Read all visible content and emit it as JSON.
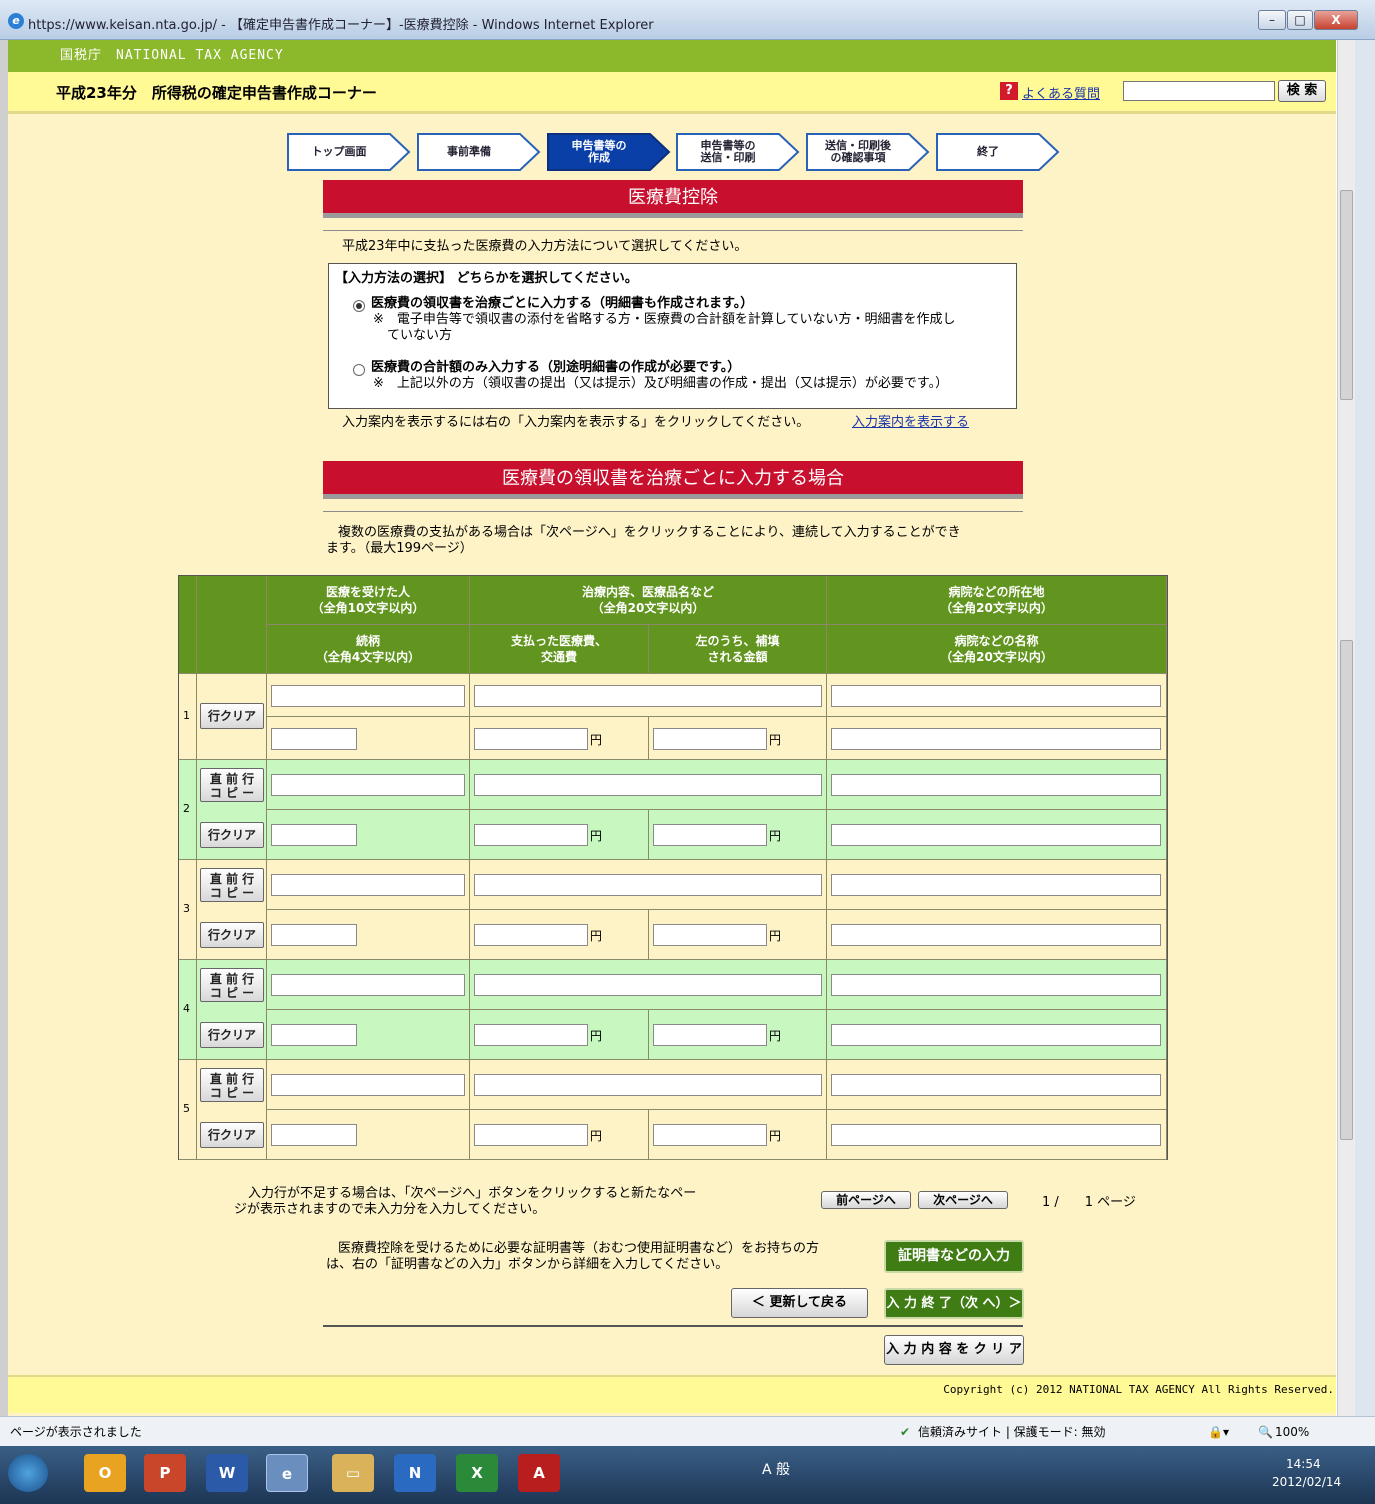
{
  "window": {
    "title": "https://www.keisan.nta.go.jp/ - 【確定申告書作成コーナー】-医療費控除 - Windows Internet Explorer",
    "min": "–",
    "max": "□",
    "close": "X"
  },
  "header": {
    "agency": "国税庁　NATIONAL TAX AGENCY",
    "page_title": "平成23年分　所得税の確定申告書作成コーナー",
    "faq_icon": "?",
    "faq_link": "よくある質問",
    "search_button": "検 索"
  },
  "steps": [
    {
      "label": "トップ画面",
      "active": false
    },
    {
      "label": "事前準備",
      "active": false
    },
    {
      "label": "申告書等の\n作成",
      "active": true
    },
    {
      "label": "申告書等の\n送信・印刷",
      "active": false
    },
    {
      "label": "送信・印刷後\nの確認事項",
      "active": false
    },
    {
      "label": "終了",
      "active": false
    }
  ],
  "section1": {
    "title": "医療費控除",
    "intro": "平成23年中に支払った医療費の入力方法について選択してください。",
    "box_heading": "【入力方法の選択】 どちらかを選択してください。",
    "option1": "医療費の領収書を治療ごとに入力する（明細書も作成されます。）",
    "option1_note1": "※　電子申告等で領収書の添付を省略する方・医療費の合計額を計算していない方・明細書を作成し",
    "option1_note2": "ていない方",
    "option2": "医療費の合計額のみ入力する（別途明細書の作成が必要です。）",
    "option2_note": "※　上記以外の方（領収書の提出（又は提示）及び明細書の作成・提出（又は提示）が必要です。）",
    "guide_text": "入力案内を表示するには右の「入力案内を表示する」をクリックしてください。",
    "guide_link": "入力案内を表示する"
  },
  "section2": {
    "title": "医療費の領収書を治療ごとに入力する場合",
    "note1": "複数の医療費の支払がある場合は「次ページへ」をクリックすることにより、連続して入力することができ",
    "note2": "ます。（最大199ページ）"
  },
  "table": {
    "h_person": "医療を受けた人\n（全角10文字以内）",
    "h_content": "治療内容、医療品名など\n（全角20文字以内）",
    "h_location": "病院などの所在地\n（全角20文字以内）",
    "h_relation": "続柄\n（全角4文字以内）",
    "h_paid": "支払った医療費、\n交通費",
    "h_reimbursed": "左のうち、補填\nされる金額",
    "h_hospital": "病院などの名称\n（全角20文字以内）",
    "yen": "円",
    "clear_row": "行クリア",
    "copy_prev": "直 前 行\nコ ピ ー",
    "row_numbers": [
      "1",
      "2",
      "3",
      "4",
      "5"
    ]
  },
  "bottom": {
    "more_rows1": "入力行が不足する場合は、「次ページへ」ボタンをクリックすると新たなペー",
    "more_rows2": "ジが表示されますので未入力分を入力してください。",
    "prev_page": "前ページへ",
    "next_page": "次ページへ",
    "page_indicator": "1 /　　1 ページ",
    "cert_text1": "医療費控除を受けるために必要な証明書等（おむつ使用証明書など）をお持ちの方",
    "cert_text2": "は、右の「証明書などの入力」ボタンから詳細を入力してください。",
    "cert_button": "証明書などの入力",
    "back_button": "＜ 更新して戻る",
    "finish_button": "入 力 終 了（次 へ）＞",
    "clear_button": "入 力 内 容 を ク リ ア",
    "copyright": "Copyright (c) 2012 NATIONAL TAX AGENCY All Rights Reserved."
  },
  "status": {
    "left": "ページが表示されました",
    "security": "信頼済みサイト | 保護モード: 無効",
    "zoom": "100%"
  },
  "taskbar": {
    "ime": "A 般",
    "time": "14:54",
    "date": "2012/02/14"
  },
  "colors": {
    "agency_green": "#8cb82b",
    "header_yellow": "#fff996",
    "page_bg": "#fdf3c7",
    "band_red": "#c8102e",
    "table_header_green": "#62951f",
    "alt_row_green": "#c8f7c0",
    "action_green": "#3f7d14",
    "link_blue": "#1a33a8"
  }
}
